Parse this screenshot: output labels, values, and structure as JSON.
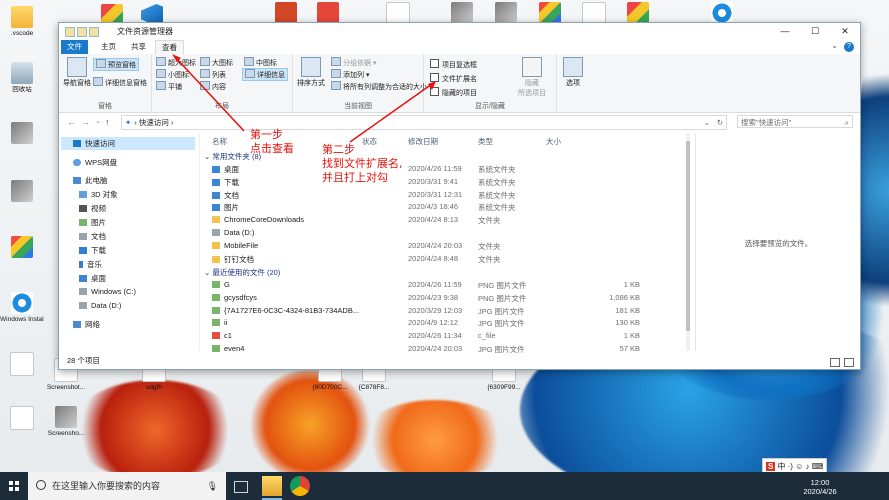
{
  "window": {
    "title": "文件资源管理器",
    "controls": {
      "minimize": "—",
      "maximize": "☐",
      "close": "✕"
    }
  },
  "tabs": [
    {
      "label": "文件"
    },
    {
      "label": "主页"
    },
    {
      "label": "共享"
    },
    {
      "label": "查看"
    }
  ],
  "ribbon": {
    "pane": {
      "nav_pane": "导航窗格",
      "preview_pane": "预览窗格",
      "details_pane": "详细信息窗格",
      "group_label": "窗格"
    },
    "layout": {
      "items": [
        "超大图标",
        "大图标",
        "中图标",
        "小图标",
        "列表",
        "详细信息",
        "平铺",
        "内容"
      ],
      "group_label": "布局"
    },
    "current_view": {
      "sort_by": "排序方式",
      "group_by": "分组依据",
      "add_column": "添加列",
      "fit_columns": "将所有列调整为合适的大小",
      "group_label": "当前视图"
    },
    "show_hide": {
      "item_checkboxes": "项目复选框",
      "file_extensions": "文件扩展名",
      "hidden_items": "隐藏的项目",
      "hide_selected": "隐藏",
      "hide_selected_2": "所选项目",
      "options": "选项",
      "group_label": "显示/隐藏"
    }
  },
  "address": {
    "path": "快速访问",
    "search_placeholder": "搜索\"快速访问\""
  },
  "nav_pane": {
    "items": [
      {
        "label": "快速访问",
        "icon": "star-icon"
      },
      {
        "label": "WPS网盘",
        "icon": "cloud-icon"
      },
      {
        "label": "此电脑",
        "icon": "computer-icon"
      },
      {
        "label": "3D 对象",
        "icon": "cube-icon"
      },
      {
        "label": "视频",
        "icon": "video-icon"
      },
      {
        "label": "图片",
        "icon": "picture-icon"
      },
      {
        "label": "文档",
        "icon": "document-icon"
      },
      {
        "label": "下载",
        "icon": "download-icon"
      },
      {
        "label": "音乐",
        "icon": "music-icon"
      },
      {
        "label": "桌面",
        "icon": "desktop-icon"
      },
      {
        "label": "Windows (C:)",
        "icon": "drive-icon"
      },
      {
        "label": "Data (D:)",
        "icon": "drive-icon"
      },
      {
        "label": "网络",
        "icon": "network-icon"
      }
    ]
  },
  "columns": {
    "name": "名称",
    "status": "状态",
    "modified": "修改日期",
    "type": "类型",
    "size": "大小"
  },
  "groups": {
    "frequent": "常用文件夹 (8)",
    "recent": "最近使用的文件 (20)"
  },
  "frequent_folders": [
    {
      "name": "桌面",
      "date": "2020/4/26 11:59",
      "type": "系统文件夹",
      "size": "",
      "icon": "blue"
    },
    {
      "name": "下载",
      "date": "2020/3/31 9:41",
      "type": "系统文件夹",
      "size": "",
      "icon": "blue"
    },
    {
      "name": "文档",
      "date": "2020/3/31 12:31",
      "type": "系统文件夹",
      "size": "",
      "icon": "blue"
    },
    {
      "name": "图片",
      "date": "2020/4/3 18:46",
      "type": "系统文件夹",
      "size": "",
      "icon": "blue"
    },
    {
      "name": "ChromeCoreDownloads",
      "date": "2020/4/24 8:13",
      "type": "文件夹",
      "size": "",
      "icon": "folder"
    },
    {
      "name": "Data (D:)",
      "date": "",
      "type": "",
      "size": "",
      "icon": "drive"
    },
    {
      "name": "MobileFile",
      "date": "2020/4/24 20:03",
      "type": "文件夹",
      "size": "",
      "icon": "folder"
    },
    {
      "name": "钉钉文档",
      "date": "2020/4/24 8:48",
      "type": "文件夹",
      "size": "",
      "icon": "folder"
    }
  ],
  "recent_files": [
    {
      "name": "G",
      "date": "2020/4/26 11:59",
      "type": "PNG 图片文件",
      "size": "1 KB",
      "icon": "img"
    },
    {
      "name": "gcysdfcys",
      "date": "2020/4/23 9:38",
      "type": "PNG 图片文件",
      "size": "1,086 KB",
      "icon": "img"
    },
    {
      "name": "{7A1727E6-0C3C-4324-81B3-734ADB...",
      "date": "2020/3/29 12:03",
      "type": "JPG 图片文件",
      "size": "181 KB",
      "icon": "img"
    },
    {
      "name": "ii",
      "date": "2020/4/9 12:12",
      "type": "JPG 图片文件",
      "size": "130 KB",
      "icon": "img"
    },
    {
      "name": "c1",
      "date": "2020/4/26 11:34",
      "type": "c_file",
      "size": "1 KB",
      "icon": "red"
    },
    {
      "name": "even4",
      "date": "2020/4/24 20:03",
      "type": "JPG 图片文件",
      "size": "57 KB",
      "icon": "img"
    }
  ],
  "preview_text": "选择要预览的文件。",
  "status": {
    "count": "28 个项目"
  },
  "annotations": {
    "step1_line1": "第一步",
    "step1_line2": "点击查看",
    "step2_line1": "第二步",
    "step2_line2": "找到文件扩展名,",
    "step2_line3": "并且打上对勾"
  },
  "desktop_icons": [
    {
      "label": ".vscode",
      "glyph": "folder"
    },
    {
      "label": "回收站",
      "glyph": "bin"
    },
    {
      "label": "Windows Installer...",
      "glyph": "ie"
    },
    {
      "label": "Screenshot...",
      "glyph": "img"
    },
    {
      "label": "sdgfh",
      "glyph": "file"
    },
    {
      "label": "Screensho...",
      "glyph": "img"
    },
    {
      "label": "{80D700C...",
      "glyph": "file"
    },
    {
      "label": "{C878F8...",
      "glyph": "file"
    },
    {
      "label": "{6309F99...",
      "glyph": "file"
    }
  ],
  "taskbar": {
    "search_placeholder": "在这里输入你要搜索的内容",
    "time": "12:00",
    "date": "2020/4/26",
    "ime_label": "中"
  }
}
